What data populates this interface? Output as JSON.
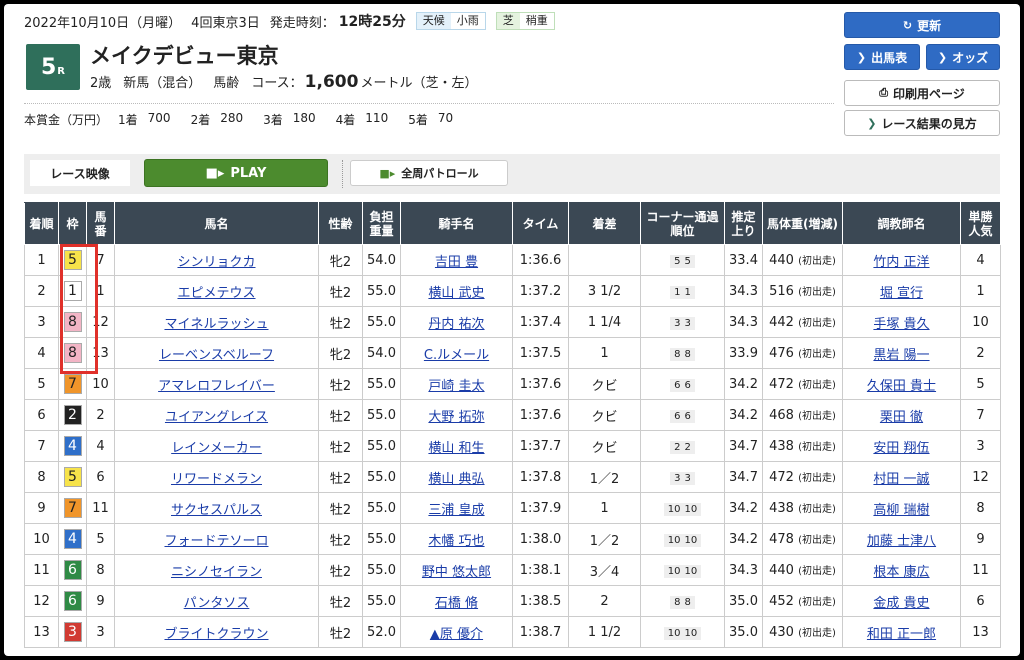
{
  "header": {
    "date": "2022年10月10日（月曜）",
    "meeting": "4回東京3日",
    "post_time_label": "発走時刻：",
    "post_time": "12時25分",
    "weather_label": "天候",
    "weather": "小雨",
    "track_label": "芝",
    "track_condition": "稍重",
    "race_num": "5",
    "race_suffix": "R",
    "race_name": "メイクデビュー東京",
    "age": "2歳",
    "class": "新馬（混合）",
    "weight_rule": "馬齢",
    "course_label": "コース：",
    "distance": "1,600",
    "distance_unit": "メートル（芝・左）"
  },
  "prize": {
    "label": "本賞金（万円）",
    "items": [
      {
        "rank": "1着",
        "amount": "700"
      },
      {
        "rank": "2着",
        "amount": "280"
      },
      {
        "rank": "3着",
        "amount": "180"
      },
      {
        "rank": "4着",
        "amount": "110"
      },
      {
        "rank": "5着",
        "amount": "70"
      }
    ]
  },
  "buttons": {
    "update": "更新",
    "entries": "出馬表",
    "odds": "オッズ",
    "print": "印刷用ページ",
    "guide": "レース結果の見方"
  },
  "video": {
    "label": "レース映像",
    "play": "PLAY",
    "patrol": "全周パトロール"
  },
  "table": {
    "headers": [
      "着順",
      "枠",
      "馬番",
      "馬名",
      "性齢",
      "負担重量",
      "騎手名",
      "タイム",
      "着差",
      "コーナー通過順位",
      "推定上り",
      "馬体重(増減)",
      "調教師名",
      "単勝人気"
    ],
    "rows": [
      {
        "rank": "1",
        "waku": "5",
        "num": "7",
        "horse": "シンリョクカ",
        "sex": "牝2",
        "wt": "54.0",
        "jockey": "吉田 豊",
        "time": "1:36.6",
        "margin": "",
        "c1": "5",
        "c2": "5",
        "agari": "33.4",
        "bw": "440",
        "bwd": "(初出走)",
        "trainer": "竹内 正洋",
        "pop": "4"
      },
      {
        "rank": "2",
        "waku": "1",
        "num": "1",
        "horse": "エピメテウス",
        "sex": "牡2",
        "wt": "55.0",
        "jockey": "横山 武史",
        "time": "1:37.2",
        "margin": "3 1/2",
        "c1": "1",
        "c2": "1",
        "agari": "34.3",
        "bw": "516",
        "bwd": "(初出走)",
        "trainer": "堀 宣行",
        "pop": "1"
      },
      {
        "rank": "3",
        "waku": "8",
        "num": "12",
        "horse": "マイネルラッシュ",
        "sex": "牡2",
        "wt": "55.0",
        "jockey": "丹内 祐次",
        "time": "1:37.4",
        "margin": "1 1/4",
        "c1": "3",
        "c2": "3",
        "agari": "34.3",
        "bw": "442",
        "bwd": "(初出走)",
        "trainer": "手塚 貴久",
        "pop": "10"
      },
      {
        "rank": "4",
        "waku": "8",
        "num": "13",
        "horse": "レーベンスベルーフ",
        "sex": "牝2",
        "wt": "54.0",
        "jockey": "C.ルメール",
        "time": "1:37.5",
        "margin": "1",
        "c1": "8",
        "c2": "8",
        "agari": "33.9",
        "bw": "476",
        "bwd": "(初出走)",
        "trainer": "黒岩 陽一",
        "pop": "2"
      },
      {
        "rank": "5",
        "waku": "7",
        "num": "10",
        "horse": "アマレロフレイバー",
        "sex": "牡2",
        "wt": "55.0",
        "jockey": "戸崎 圭太",
        "time": "1:37.6",
        "margin": "クビ",
        "c1": "6",
        "c2": "6",
        "agari": "34.2",
        "bw": "472",
        "bwd": "(初出走)",
        "trainer": "久保田 貴士",
        "pop": "5"
      },
      {
        "rank": "6",
        "waku": "2",
        "num": "2",
        "horse": "ユイアングレイス",
        "sex": "牡2",
        "wt": "55.0",
        "jockey": "大野 拓弥",
        "time": "1:37.6",
        "margin": "クビ",
        "c1": "6",
        "c2": "6",
        "agari": "34.2",
        "bw": "468",
        "bwd": "(初出走)",
        "trainer": "栗田 徹",
        "pop": "7"
      },
      {
        "rank": "7",
        "waku": "4",
        "num": "4",
        "horse": "レインメーカー",
        "sex": "牡2",
        "wt": "55.0",
        "jockey": "横山 和生",
        "time": "1:37.7",
        "margin": "クビ",
        "c1": "2",
        "c2": "2",
        "agari": "34.7",
        "bw": "438",
        "bwd": "(初出走)",
        "trainer": "安田 翔伍",
        "pop": "3"
      },
      {
        "rank": "8",
        "waku": "5",
        "num": "6",
        "horse": "リワードメラン",
        "sex": "牡2",
        "wt": "55.0",
        "jockey": "横山 典弘",
        "time": "1:37.8",
        "margin": "1／2",
        "c1": "3",
        "c2": "3",
        "agari": "34.7",
        "bw": "472",
        "bwd": "(初出走)",
        "trainer": "村田 一誠",
        "pop": "12"
      },
      {
        "rank": "9",
        "waku": "7",
        "num": "11",
        "horse": "サクセスパルス",
        "sex": "牡2",
        "wt": "55.0",
        "jockey": "三浦 皇成",
        "time": "1:37.9",
        "margin": "1",
        "c1": "10",
        "c2": "10",
        "agari": "34.2",
        "bw": "438",
        "bwd": "(初出走)",
        "trainer": "高柳 瑞樹",
        "pop": "8"
      },
      {
        "rank": "10",
        "waku": "4",
        "num": "5",
        "horse": "フォードテソーロ",
        "sex": "牡2",
        "wt": "55.0",
        "jockey": "木幡 巧也",
        "time": "1:38.0",
        "margin": "1／2",
        "c1": "10",
        "c2": "10",
        "agari": "34.2",
        "bw": "478",
        "bwd": "(初出走)",
        "trainer": "加藤 士津八",
        "pop": "9"
      },
      {
        "rank": "11",
        "waku": "6",
        "num": "8",
        "horse": "ニシノセイラン",
        "sex": "牡2",
        "wt": "55.0",
        "jockey": "野中 悠太郎",
        "time": "1:38.1",
        "margin": "3／4",
        "c1": "10",
        "c2": "10",
        "agari": "34.3",
        "bw": "440",
        "bwd": "(初出走)",
        "trainer": "根本 康広",
        "pop": "11"
      },
      {
        "rank": "12",
        "waku": "6",
        "num": "9",
        "horse": "パンタソス",
        "sex": "牡2",
        "wt": "55.0",
        "jockey": "石橋 脩",
        "time": "1:38.5",
        "margin": "2",
        "c1": "8",
        "c2": "8",
        "agari": "35.0",
        "bw": "452",
        "bwd": "(初出走)",
        "trainer": "金成 貴史",
        "pop": "6"
      },
      {
        "rank": "13",
        "waku": "3",
        "num": "3",
        "horse": "ブライトクラウン",
        "sex": "牡2",
        "wt": "52.0",
        "jockey": "▲原 優介",
        "time": "1:38.7",
        "margin": "1 1/2",
        "c1": "10",
        "c2": "10",
        "agari": "35.0",
        "bw": "430",
        "bwd": "(初出走)",
        "trainer": "和田 正一郎",
        "pop": "13"
      }
    ]
  },
  "waku_colors": {
    "1": {
      "bg": "#ffffff",
      "fg": "#222222"
    },
    "2": {
      "bg": "#222222",
      "fg": "#ffffff"
    },
    "3": {
      "bg": "#d13a32",
      "fg": "#ffffff"
    },
    "4": {
      "bg": "#2f6fc9",
      "fg": "#ffffff"
    },
    "5": {
      "bg": "#f7e34a",
      "fg": "#222222"
    },
    "6": {
      "bg": "#2f8a45",
      "fg": "#ffffff"
    },
    "7": {
      "bg": "#f0952a",
      "fg": "#222222"
    },
    "8": {
      "bg": "#f3b5c6",
      "fg": "#222222"
    }
  },
  "highlight_color": "#e0302a"
}
